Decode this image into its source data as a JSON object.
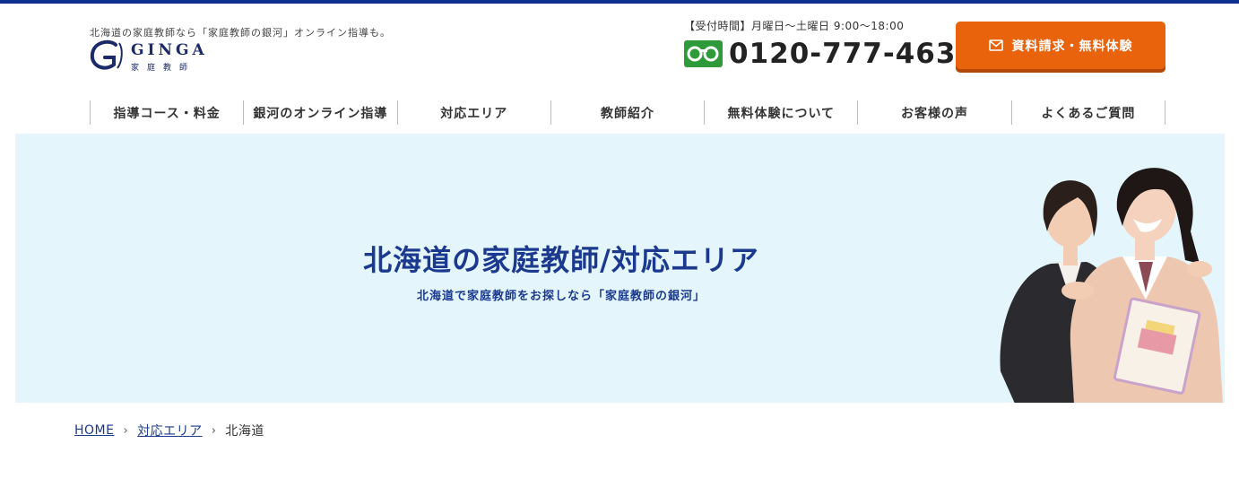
{
  "header": {
    "tagline": "北海道の家庭教師なら「家庭教師の銀河」オンライン指導も。",
    "logo_text": "GINGA",
    "logo_subtitle": "家庭教師",
    "hours": "【受付時間】月曜日〜土曜日 9:00〜18:00",
    "phone": "0120-777-463",
    "cta_label": "資料請求・無料体験"
  },
  "nav": {
    "items": [
      {
        "label": "指導コース・料金"
      },
      {
        "label": "銀河のオンライン指導"
      },
      {
        "label": "対応エリア"
      },
      {
        "label": "教師紹介"
      },
      {
        "label": "無料体験について"
      },
      {
        "label": "お客様の声"
      },
      {
        "label": "よくあるご質問"
      }
    ]
  },
  "hero": {
    "title": "北海道の家庭教師/対応エリア",
    "subtitle": "北海道で家庭教師をお探しなら「家庭教師の銀河」"
  },
  "breadcrumb": {
    "home": "HOME",
    "area": "対応エリア",
    "current": "北海道",
    "separator": "›"
  },
  "colors": {
    "brand_navy": "#1b3a8f",
    "top_bar": "#0d2f8f",
    "cta_orange": "#e9620c",
    "freedial_green": "#2f9a3a",
    "hero_bg": "#e4f5fc"
  },
  "icons": {
    "cta": "envelope-icon",
    "phone": "freedial-icon",
    "breadcrumb": "chevron-right-icon"
  }
}
